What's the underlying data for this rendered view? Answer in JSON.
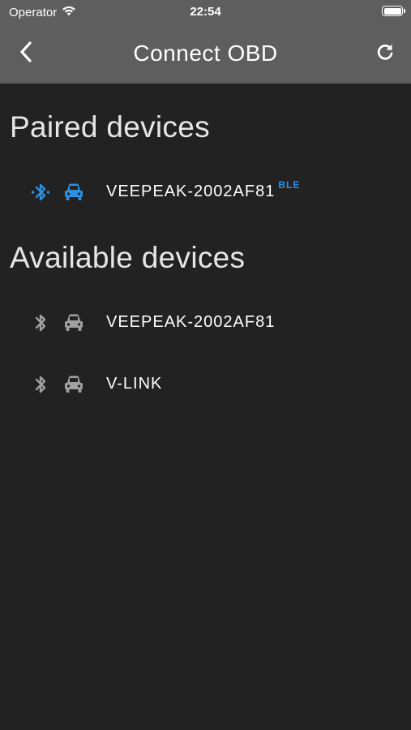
{
  "status_bar": {
    "carrier": "Operator",
    "time": "22:54"
  },
  "nav": {
    "title": "Connect OBD",
    "back_icon": "chevron-left-icon",
    "refresh_icon": "refresh-icon"
  },
  "paired": {
    "title": "Paired devices",
    "devices": [
      {
        "name": "VEEPEAK-2002AF81",
        "badge": "BLE",
        "active": true
      }
    ]
  },
  "available": {
    "title": "Available devices",
    "devices": [
      {
        "name": "VEEPEAK-2002AF81",
        "active": false
      },
      {
        "name": "V-LINK",
        "active": false
      }
    ]
  },
  "colors": {
    "header": "#5e5e5e",
    "background": "#222222",
    "accent": "#2d8fe0",
    "inactive_icon": "#a0a0a0"
  }
}
